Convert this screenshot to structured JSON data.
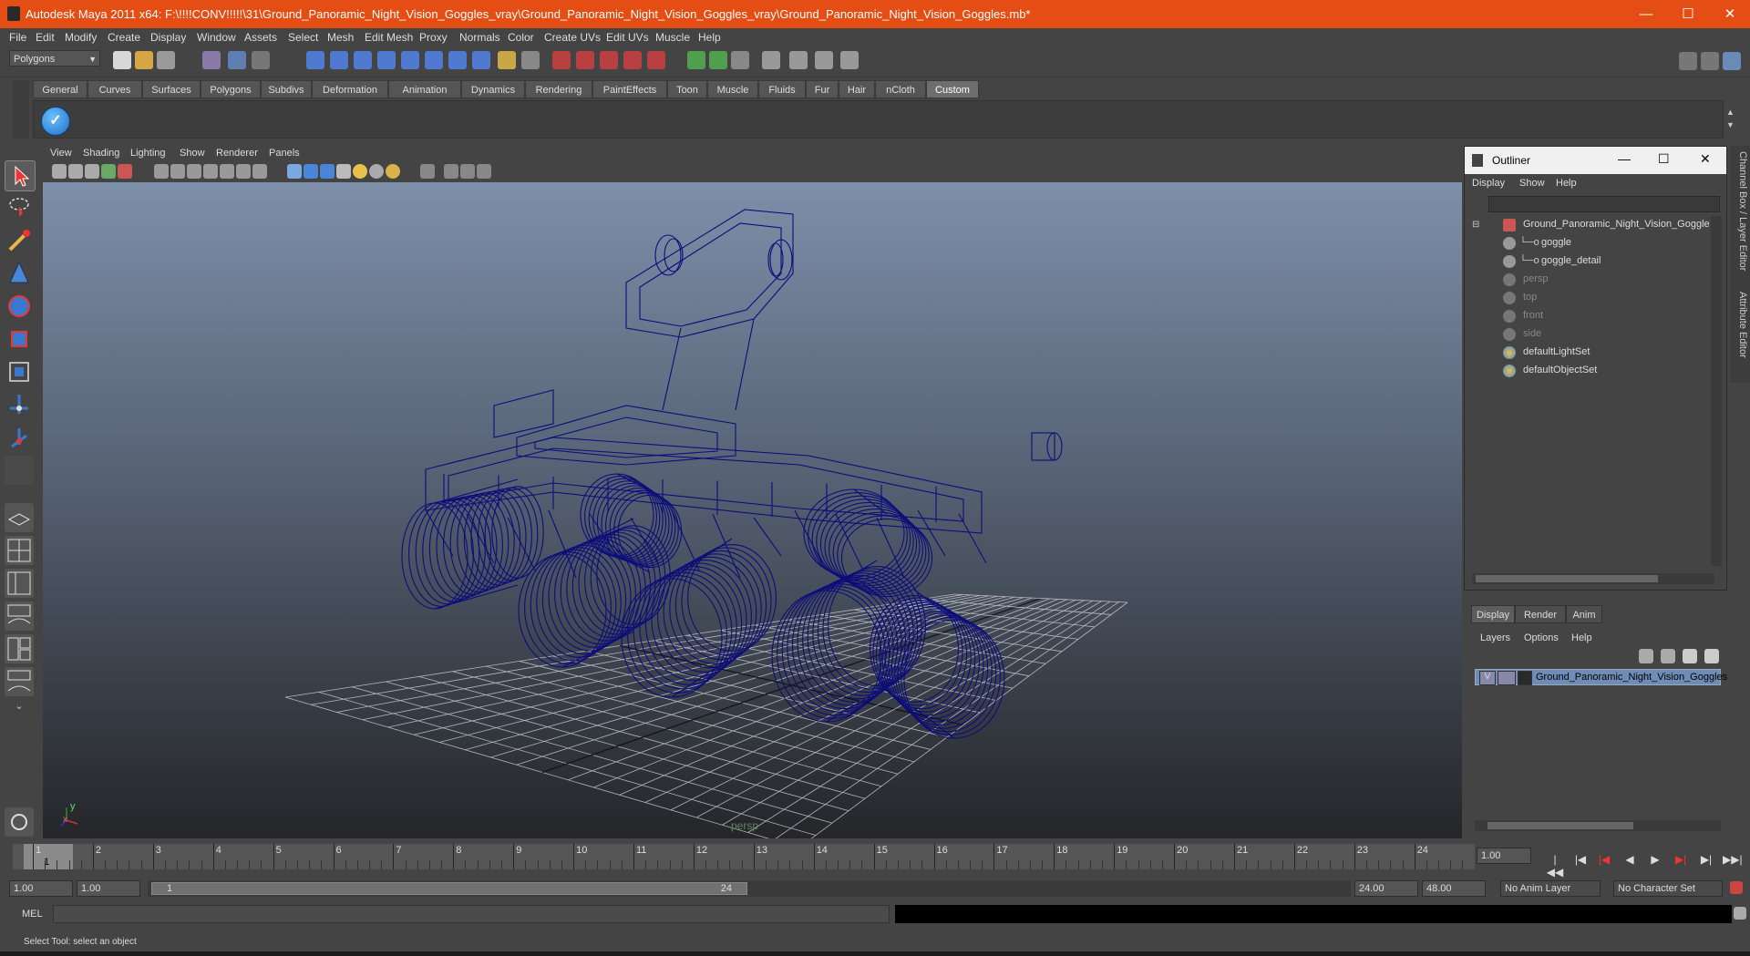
{
  "window": {
    "title": "Autodesk Maya 2011 x64: F:\\!!!!CONV!!!!!\\31\\Ground_Panoramic_Night_Vision_Goggles_vray\\Ground_Panoramic_Night_Vision_Goggles_vray\\Ground_Panoramic_Night_Vision_Goggles.mb*",
    "minimize": "—",
    "maximize": "☐",
    "close": "✕"
  },
  "menubar": [
    "File",
    "Edit",
    "Modify",
    "Create",
    "Display",
    "Window",
    "Assets",
    "Select",
    "Mesh",
    "Edit Mesh",
    "Proxy",
    "Normals",
    "Color",
    "Create UVs",
    "Edit UVs",
    "Muscle",
    "Help"
  ],
  "statusline": {
    "mode_selector": "Polygons"
  },
  "shelf": {
    "tabs": [
      "General",
      "Curves",
      "Surfaces",
      "Polygons",
      "Subdivs",
      "Deformation",
      "Animation",
      "Dynamics",
      "Rendering",
      "PaintEffects",
      "Toon",
      "Muscle",
      "Fluids",
      "Fur",
      "Hair",
      "nCloth",
      "Custom"
    ],
    "active_tab": "Custom"
  },
  "viewport": {
    "menus": [
      "View",
      "Shading",
      "Lighting",
      "Show",
      "Renderer",
      "Panels"
    ],
    "camera_label": "persp",
    "axis_y": "y",
    "axis_x": "x"
  },
  "outliner": {
    "title": "Outliner",
    "menus": [
      "Display",
      "Show",
      "Help"
    ],
    "items": [
      {
        "label": "Ground_Panoramic_Night_Vision_Goggle",
        "icon": "group-icon"
      },
      {
        "label": "goggle",
        "icon": "mesh-icon"
      },
      {
        "label": "goggle_detail",
        "icon": "mesh-icon"
      },
      {
        "label": "persp",
        "icon": "camera-icon"
      },
      {
        "label": "top",
        "icon": "camera-icon"
      },
      {
        "label": "front",
        "icon": "camera-icon"
      },
      {
        "label": "side",
        "icon": "camera-icon"
      },
      {
        "label": "defaultLightSet",
        "icon": "set-icon"
      },
      {
        "label": "defaultObjectSet",
        "icon": "set-icon"
      }
    ]
  },
  "side_tabs": [
    "Channel Box / Layer Editor",
    "Attribute Editor"
  ],
  "layer_editor": {
    "tabs": [
      "Display",
      "Render",
      "Anim"
    ],
    "active_tab": "Display",
    "menus": [
      "Layers",
      "Options",
      "Help"
    ],
    "layer": {
      "visible": "V",
      "name": "Ground_Panoramic_Night_Vision_Goggles"
    }
  },
  "timeline": {
    "ticks": [
      "1",
      "2",
      "3",
      "4",
      "5",
      "6",
      "7",
      "8",
      "9",
      "10",
      "11",
      "12",
      "13",
      "14",
      "15",
      "16",
      "17",
      "18",
      "19",
      "20",
      "21",
      "22",
      "23",
      "24"
    ],
    "current_frame_label": "1",
    "current_time": "1.00"
  },
  "range": {
    "start": "1.00",
    "playback_start": "1.00",
    "slider_start": "1",
    "slider_end": "24",
    "playback_end": "24.00",
    "end": "48.00",
    "anim_layer": "No Anim Layer",
    "character_set": "No Character Set"
  },
  "command": {
    "label": "MEL"
  },
  "help_line": "Select Tool: select an object",
  "colors": {
    "titlebar": "#e44d13",
    "wireframe": "#0d0d7a",
    "layer_highlight": "#6e8cb6"
  }
}
